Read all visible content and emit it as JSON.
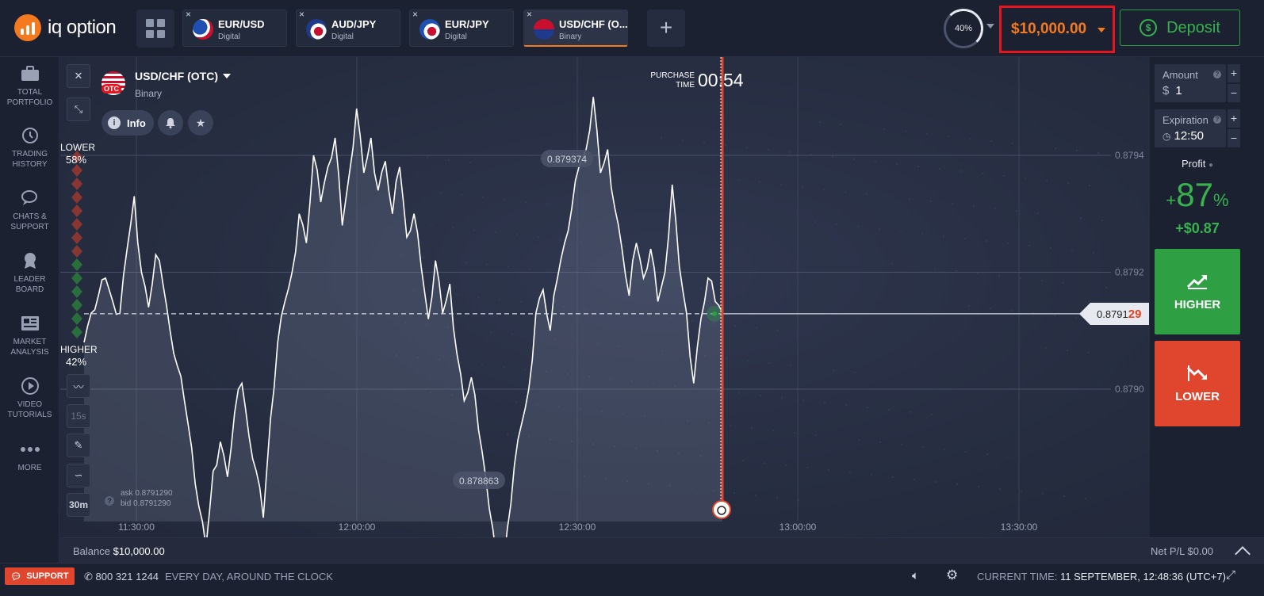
{
  "app": {
    "logo_text": "iq option"
  },
  "tabs": [
    {
      "name": "EUR/USD",
      "kind": "Digital",
      "active": false
    },
    {
      "name": "AUD/JPY",
      "kind": "Digital",
      "active": false
    },
    {
      "name": "EUR/JPY",
      "kind": "Digital",
      "active": false
    },
    {
      "name": "USD/CHF (O...",
      "kind": "Binary",
      "active": true
    }
  ],
  "header": {
    "add_tab_label": "+",
    "progress_label": "40%",
    "balance": "$10,000.00",
    "deposit_label": "Deposit"
  },
  "sidebar": {
    "items": [
      {
        "label": "TOTAL\nPORTFOLIO",
        "icon": "briefcase-icon"
      },
      {
        "label": "TRADING\nHISTORY",
        "icon": "history-icon"
      },
      {
        "label": "CHATS &\nSUPPORT",
        "icon": "chat-icon"
      },
      {
        "label": "LEADER\nBOARD",
        "icon": "medal-icon"
      },
      {
        "label": "MARKET\nANALYSIS",
        "icon": "newspaper-icon"
      },
      {
        "label": "VIDEO\nTUTORIALS",
        "icon": "play-icon"
      },
      {
        "label": "MORE",
        "icon": "more-icon"
      }
    ]
  },
  "asset": {
    "title": "USD/CHF (OTC)",
    "subtitle": "Binary",
    "otc_badge": "OTC",
    "info_label": "Info"
  },
  "purchase": {
    "label_line1": "PURCHASE",
    "label_line2": "TIME",
    "time": "00:54"
  },
  "sentiment": {
    "lower_label": "LOWER",
    "lower_pct": "58%",
    "higher_label": "HIGHER",
    "higher_pct": "42%"
  },
  "tools": {
    "interval_label": "15s",
    "timeframe_label": "30m"
  },
  "quote": {
    "price_prefix": "0.8791",
    "price_suffix": "29",
    "ask": "ask 0.8791290",
    "bid": "bid 0.8791290",
    "high_label": "0.879374",
    "low_label": "0.878863"
  },
  "chart_data": {
    "type": "line",
    "series_color": "#ffffff",
    "x_tick_labels": [
      "11:30:00",
      "12:00:00",
      "12:30:00",
      "13:00:00",
      "13:30:00"
    ],
    "y_tick_labels": [
      "0.8794",
      "0.8792",
      "0.8790"
    ],
    "current_price": 0.879129,
    "high": 0.879374,
    "low": 0.878863,
    "y": [
      0.87908,
      0.87913,
      0.87916,
      0.87919,
      0.87915,
      0.87913,
      0.87924,
      0.87933,
      0.8792,
      0.87914,
      0.87923,
      0.87918,
      0.8791,
      0.87904,
      0.87898,
      0.8789,
      0.8788,
      0.87873,
      0.87886,
      0.87891,
      0.87885,
      0.87896,
      0.87901,
      0.87892,
      0.87886,
      0.87878,
      0.87895,
      0.87908,
      0.87915,
      0.8792,
      0.8793,
      0.87925,
      0.8794,
      0.87932,
      0.87938,
      0.87943,
      0.87928,
      0.87937,
      0.87948,
      0.87937,
      0.87943,
      0.87934,
      0.87939,
      0.8793,
      0.87938,
      0.87926,
      0.8793,
      0.87921,
      0.87912,
      0.87922,
      0.87913,
      0.87918,
      0.87906,
      0.87898,
      0.87902,
      0.87893,
      0.87885,
      0.87876,
      0.87864,
      0.87876,
      0.87887,
      0.87894,
      0.879,
      0.87913,
      0.87917,
      0.8791,
      0.87919,
      0.87925,
      0.87931,
      0.87938,
      0.87941,
      0.8795,
      0.87937,
      0.87941,
      0.87931,
      0.87924,
      0.87916,
      0.87925,
      0.87919,
      0.87924,
      0.87915,
      0.8792,
      0.87935,
      0.87921,
      0.87913,
      0.87901,
      0.87912,
      0.87919,
      0.87915,
      0.87913
    ]
  },
  "right_panel": {
    "amount_label": "Amount",
    "amount_currency": "$",
    "amount_value": "1",
    "expiration_label": "Expiration",
    "expiration_value": "12:50",
    "profit_label": "Profit",
    "profit_sign": "+",
    "profit_pct": "87",
    "profit_pct_unit": "%",
    "profit_amount": "+$0.87",
    "higher_label": "HIGHER",
    "lower_label": "LOWER"
  },
  "balance_strip": {
    "balance_label": "Balance",
    "balance_value": "$10,000.00",
    "net_pl": "Net P/L $0.00"
  },
  "footer": {
    "support_label": "SUPPORT",
    "phone": "800 321 1244",
    "hours": "EVERY DAY, AROUND THE CLOCK",
    "current_time_label": "CURRENT TIME:",
    "current_time_value": "11 SEPTEMBER, 12:48:36 (UTC+7)"
  },
  "colors": {
    "accent_orange": "#f47a20",
    "higher_green": "#2ea043",
    "lower_red": "#e0452e",
    "annotation_red": "#e5141f"
  }
}
